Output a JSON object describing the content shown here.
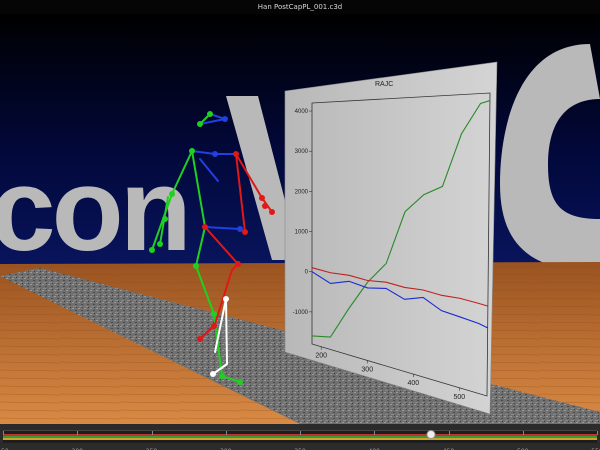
{
  "window": {
    "title": "Han PostCapPL_001.c3d"
  },
  "scene": {
    "backdrop_text": "con",
    "backdrop_color": "#000a4a",
    "floor_color": "#b86a2c",
    "walkway_color": "#6f6f6f"
  },
  "plot_panel": {
    "title": "RAJC",
    "y_ticks": [
      "4000",
      "3000",
      "2000",
      "1000",
      "0",
      "-1000"
    ],
    "x_ticks": [
      "200",
      "300",
      "400",
      "500"
    ],
    "series_colors": [
      "#2a8a2a",
      "#c02020",
      "#1a2ad0"
    ]
  },
  "chart_data": {
    "type": "line",
    "title": "RAJC",
    "xlim": [
      180,
      560
    ],
    "ylim": [
      -1800,
      4200
    ],
    "x": [
      180,
      220,
      260,
      300,
      340,
      380,
      420,
      460,
      500,
      540,
      560
    ],
    "series": [
      {
        "values": [
          -1600,
          -1500,
          -700,
          0,
          500,
          1700,
          2100,
          2300,
          3400,
          4000,
          4050
        ]
      },
      {
        "values": [
          100,
          60,
          80,
          40,
          80,
          40,
          60,
          20,
          30,
          0,
          -20
        ]
      },
      {
        "values": [
          0,
          -200,
          -60,
          -130,
          -60,
          -220,
          -100,
          -300,
          -350,
          -400,
          -450
        ]
      }
    ]
  },
  "timeline": {
    "ticks": [
      "150",
      "200",
      "250",
      "300",
      "350",
      "400",
      "450",
      "500",
      "550"
    ],
    "stripes": [
      "#c03030",
      "#3a9a3a",
      "#c9a227"
    ],
    "current_frame_fraction": 0.72
  },
  "skeleton": {
    "colors": {
      "left": "#20d020",
      "right": "#e01818",
      "center": "#2040e0",
      "foot": "#ffffff"
    }
  }
}
